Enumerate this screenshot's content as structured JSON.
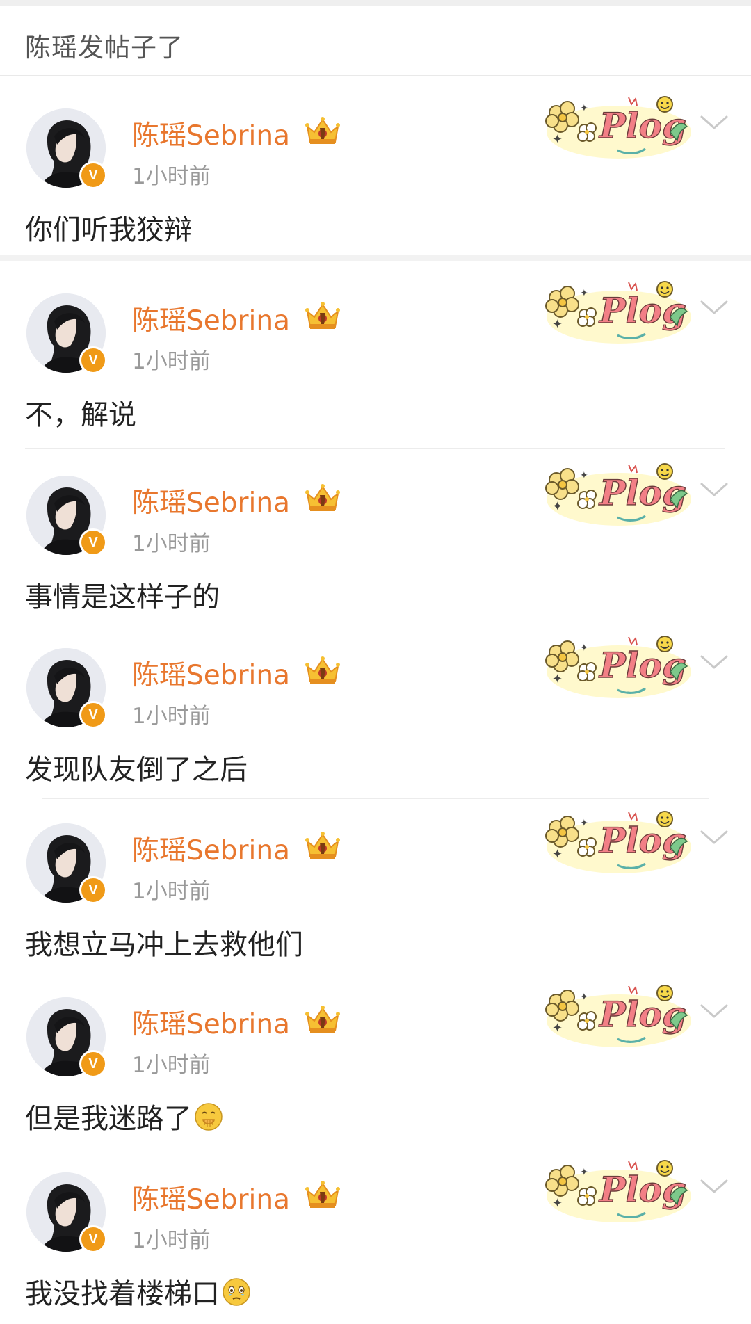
{
  "header": {
    "title": "陈瑶发帖子了"
  },
  "posts": [
    {
      "username": "陈瑶Sebrina",
      "badge": "V",
      "time": "1小时前",
      "text": "你们听我狡辩",
      "emoji": ""
    },
    {
      "username": "陈瑶Sebrina",
      "badge": "V",
      "time": "1小时前",
      "text": "不，解说",
      "emoji": ""
    },
    {
      "username": "陈瑶Sebrina",
      "badge": "V",
      "time": "1小时前",
      "text": "事情是这样子的",
      "emoji": ""
    },
    {
      "username": "陈瑶Sebrina",
      "badge": "V",
      "time": "1小时前",
      "text": "发现队友倒了之后",
      "emoji": ""
    },
    {
      "username": "陈瑶Sebrina",
      "badge": "V",
      "time": "1小时前",
      "text": "我想立马冲上去救他们",
      "emoji": ""
    },
    {
      "username": "陈瑶Sebrina",
      "badge": "V",
      "time": "1小时前",
      "text": "但是我迷路了",
      "emoji": "smiling-face-with-hand-icon"
    },
    {
      "username": "陈瑶Sebrina",
      "badge": "V",
      "time": "1小时前",
      "text": "我没找着楼梯口",
      "emoji": "holding-back-tears-icon"
    }
  ],
  "plog_sticker": {
    "text": "Plog"
  },
  "colors": {
    "username": "#e8772e",
    "verified_badge": "#f09a17",
    "time": "#999999",
    "divider": "#ececec"
  }
}
